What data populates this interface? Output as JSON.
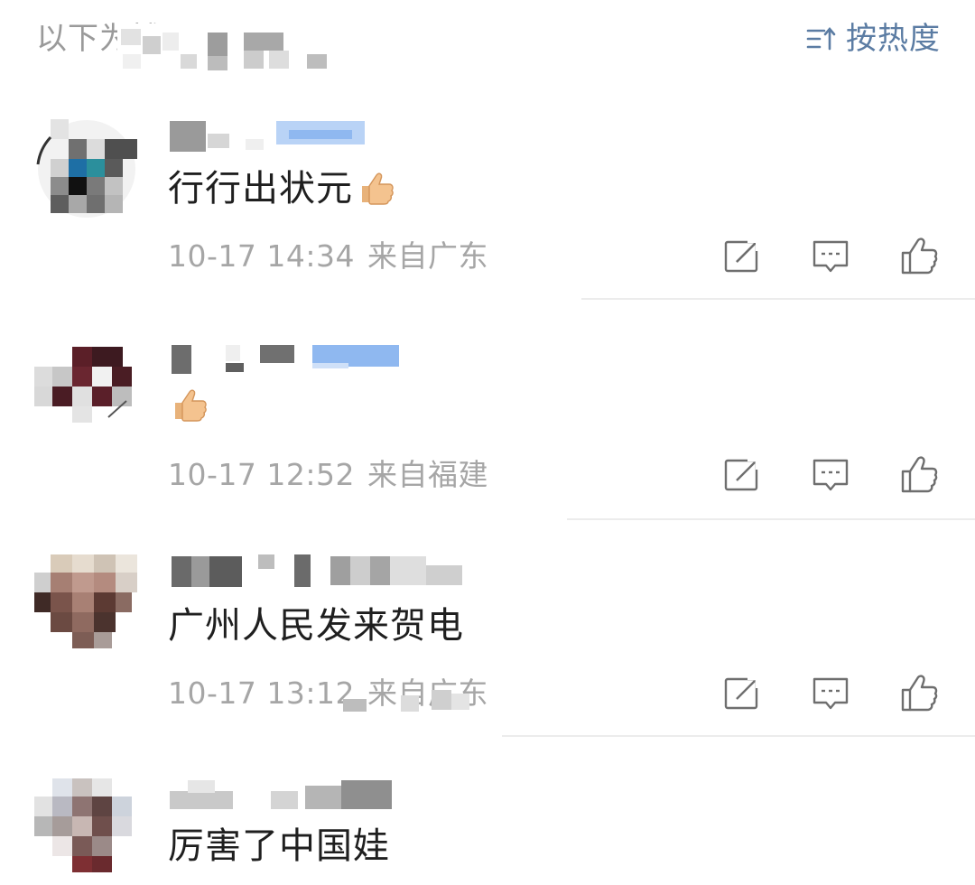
{
  "header": {
    "label": "以下为博",
    "sort_label": "按热度",
    "sort_icon": "sort-icon"
  },
  "comments": [
    {
      "text": "行行出状元",
      "emoji": "thumbs-up-emoji",
      "date": "10-17 14:34",
      "location": "来自广东"
    },
    {
      "text": "",
      "emoji": "thumbs-up-emoji",
      "date": "10-17 12:52",
      "location": "来自福建"
    },
    {
      "text": "广州人民发来贺电",
      "emoji": "",
      "date": "10-17 13:12",
      "location": "来自广东"
    },
    {
      "text": "厉害了中国娃",
      "emoji": "",
      "date": "",
      "location": ""
    }
  ],
  "action_icons": [
    "share-icon",
    "comment-icon",
    "like-icon"
  ],
  "colors": {
    "accent": "#5b7ca3",
    "text": "#1f1f1f",
    "meta": "#a6a6a6",
    "divider": "#ececec",
    "verified_tag": "#8fb8f0"
  }
}
